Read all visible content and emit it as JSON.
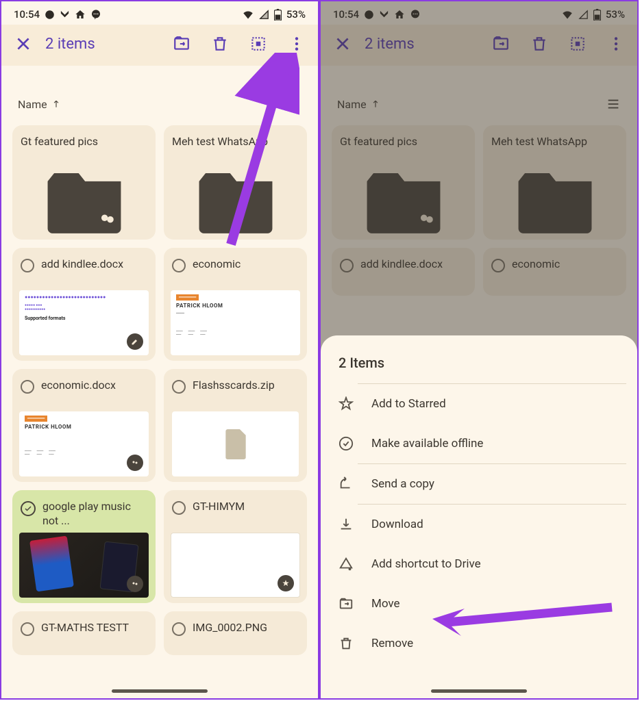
{
  "statusbar": {
    "time": "10:54",
    "battery": "53%"
  },
  "actionbar": {
    "title": "2 items"
  },
  "sort": {
    "label": "Name"
  },
  "folders": [
    "Gt featured pics",
    "Meh test WhatsApp"
  ],
  "files": [
    {
      "name": "add kindlee.docx"
    },
    {
      "name": "economic"
    },
    {
      "name": "economic.docx"
    },
    {
      "name": "Flashsscards.zip"
    },
    {
      "name": "google play music not ...",
      "selected": true
    },
    {
      "name": "GT-HIMYM"
    },
    {
      "name": "GT-MATHS TESTT"
    },
    {
      "name": "IMG_0002.PNG"
    }
  ],
  "sheet": {
    "title": "2 Items",
    "items": [
      "Add to Starred",
      "Make available offline",
      "Send a copy",
      "Download",
      "Add shortcut to Drive",
      "Move",
      "Remove"
    ]
  }
}
